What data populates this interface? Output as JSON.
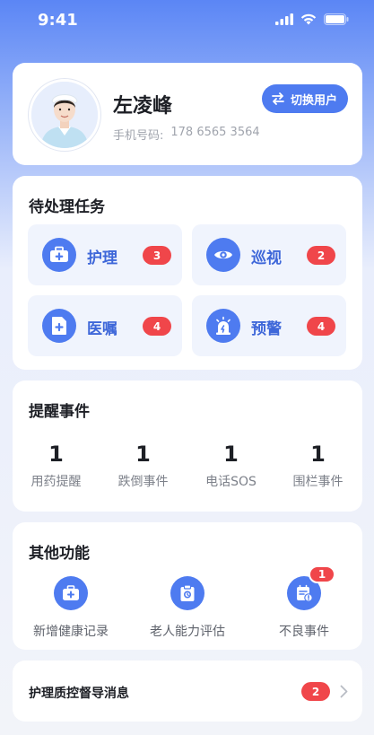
{
  "status_bar": {
    "time": "9:41"
  },
  "profile": {
    "name": "左凌峰",
    "phone_label": "手机号码:",
    "phone": "178 6565 3564",
    "switch_label": "切换用户"
  },
  "tasks": {
    "title": "待处理任务",
    "items": [
      {
        "label": "护理",
        "count": "3",
        "icon": "first-aid-kit-icon"
      },
      {
        "label": "巡视",
        "count": "2",
        "icon": "eye-icon"
      },
      {
        "label": "医嘱",
        "count": "4",
        "icon": "document-plus-icon"
      },
      {
        "label": "预警",
        "count": "4",
        "icon": "alarm-light-icon"
      }
    ]
  },
  "reminders": {
    "title": "提醒事件",
    "items": [
      {
        "value": "1",
        "label": "用药提醒"
      },
      {
        "value": "1",
        "label": "跌倒事件"
      },
      {
        "value": "1",
        "label": "电话SOS"
      },
      {
        "value": "1",
        "label": "围栏事件"
      }
    ]
  },
  "other": {
    "title": "其他功能",
    "items": [
      {
        "label": "新增健康记录",
        "icon": "medical-kit-icon"
      },
      {
        "label": "老人能力评估",
        "icon": "clipboard-icon"
      },
      {
        "label": "不良事件",
        "icon": "calendar-alert-icon",
        "badge": "1"
      }
    ]
  },
  "message": {
    "title": "护理质控督导消息",
    "count": "2"
  },
  "colors": {
    "primary": "#4e7bf0",
    "badge": "#f0464a"
  }
}
